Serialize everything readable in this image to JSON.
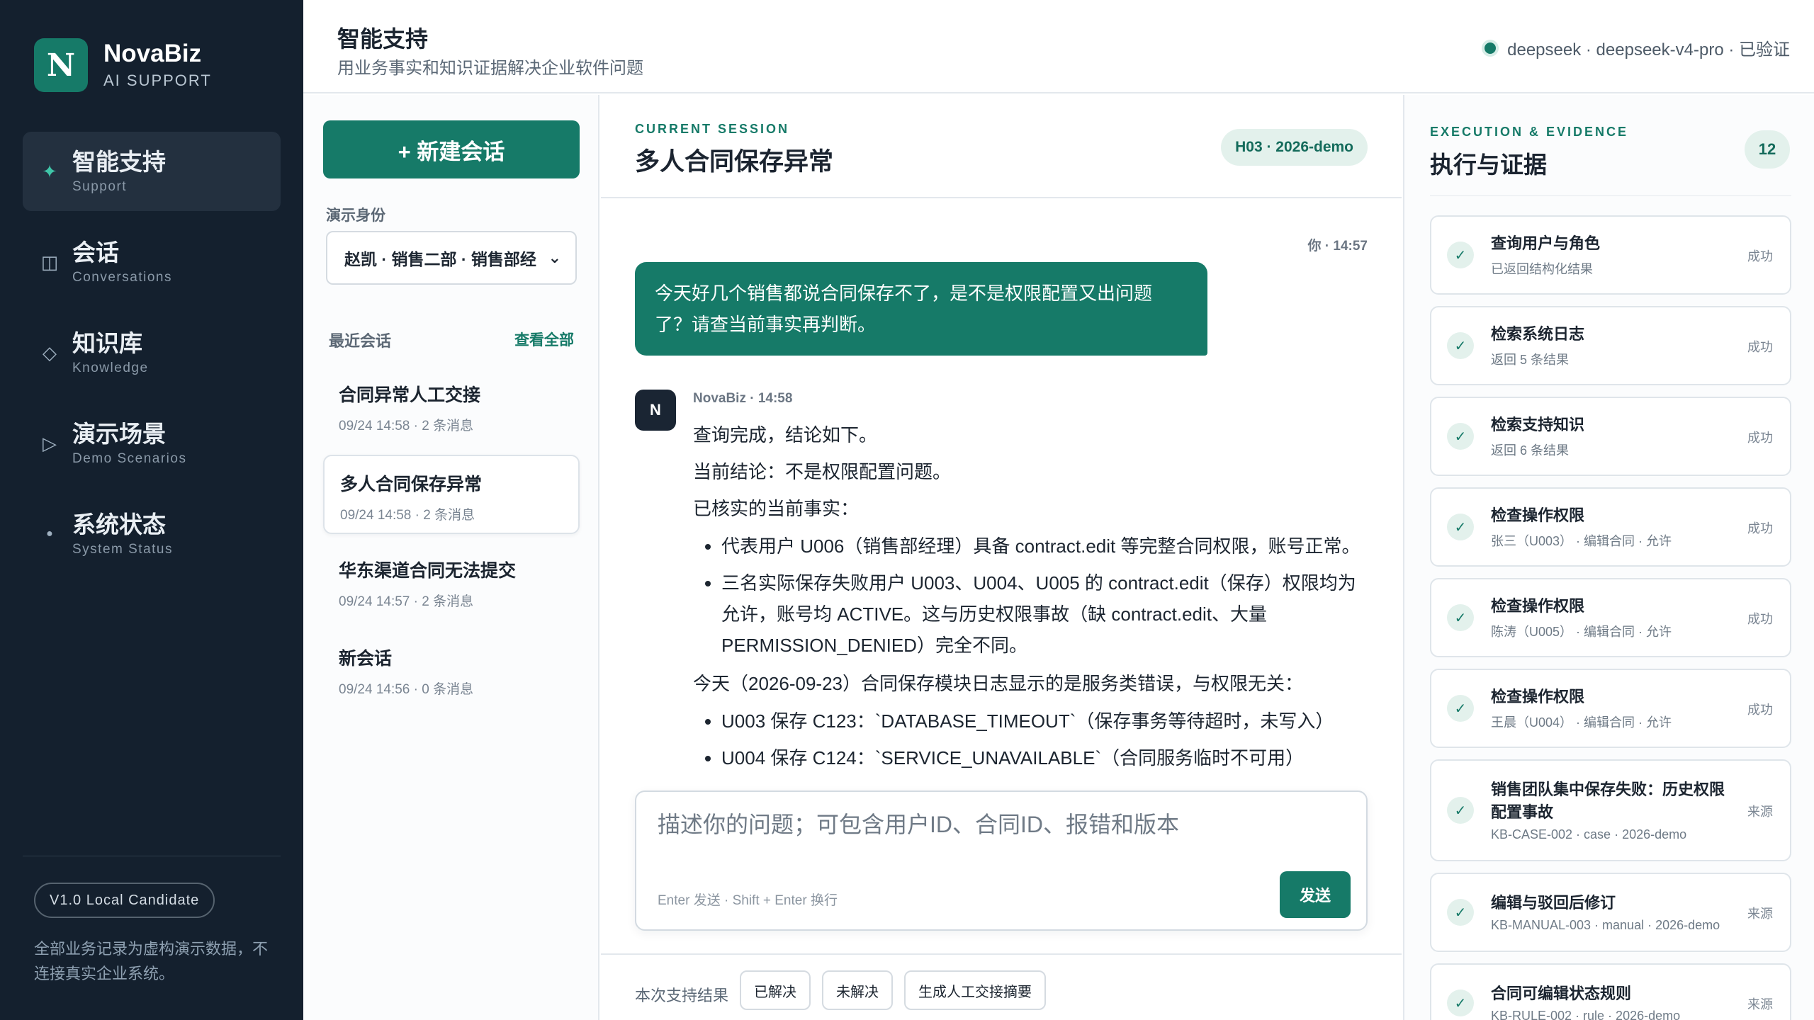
{
  "brand": {
    "logo": "N",
    "name": "NovaBiz",
    "subtitle": "AI SUPPORT"
  },
  "nav": [
    {
      "icon": "sparkle-icon",
      "glyph": "✦",
      "label": "智能支持",
      "sub": "Support",
      "active": true
    },
    {
      "icon": "columns-icon",
      "glyph": "◫",
      "label": "会话",
      "sub": "Conversations",
      "active": false
    },
    {
      "icon": "diamond-icon",
      "glyph": "◇",
      "label": "知识库",
      "sub": "Knowledge",
      "active": false
    },
    {
      "icon": "play-icon",
      "glyph": "▷",
      "label": "演示场景",
      "sub": "Demo Scenarios",
      "active": false
    },
    {
      "icon": "dot-icon",
      "glyph": "●",
      "label": "系统状态",
      "sub": "System Status",
      "active": false
    }
  ],
  "sidebar_footer": {
    "version": "V1.0 Local Candidate",
    "note": "全部业务记录为虚构演示数据，不连接真实企业系统。"
  },
  "header": {
    "title": "智能支持",
    "subtitle": "用业务事实和知识证据解决企业软件问题",
    "status": "deepseek · deepseek-v4-pro · 已验证"
  },
  "conversations": {
    "new_button": "+ 新建会话",
    "identity_label": "演示身份",
    "identity_value": "赵凯 · 销售二部 · 销售部经",
    "recent_label": "最近会话",
    "view_all": "查看全部",
    "items": [
      {
        "title": "合同异常人工交接",
        "meta": "09/24 14:58 · 2 条消息",
        "active": false
      },
      {
        "title": "多人合同保存异常",
        "meta": "09/24 14:58 · 2 条消息",
        "active": true
      },
      {
        "title": "华东渠道合同无法提交",
        "meta": "09/24 14:57 · 2 条消息",
        "active": false
      },
      {
        "title": "新会话",
        "meta": "09/24 14:56 · 0 条消息",
        "active": false
      }
    ]
  },
  "session": {
    "eyebrow": "CURRENT SESSION",
    "title": "多人合同保存异常",
    "tag": "H03 · 2026-demo"
  },
  "messages": {
    "user_meta": "你 · 14:57",
    "user_text": "今天好几个销售都说合同保存不了，是不是权限配置又出问题了？请查当前事实再判断。",
    "bot_avatar": "N",
    "bot_meta": "NovaBiz · 14:58",
    "bot_p1": "查询完成，结论如下。",
    "bot_p2": "当前结论：不是权限配置问题。",
    "bot_p3": "已核实的当前事实：",
    "bot_list1": [
      "代表用户 U006（销售部经理）具备 contract.edit 等完整合同权限，账号正常。",
      "三名实际保存失败用户 U003、U004、U005 的 contract.edit（保存）权限均为允许，账号均 ACTIVE。这与历史权限事故（缺 contract.edit、大量 PERMISSION_DENIED）完全不同。"
    ],
    "bot_p4": "今天（2026-09-23）合同保存模块日志显示的是服务类错误，与权限无关：",
    "bot_list2": [
      "U003 保存 C123：`DATABASE_TIMEOUT`（保存事务等待超时，未写入）",
      "U004 保存 C124：`SERVICE_UNAVAILABLE`（合同服务临时不可用）"
    ]
  },
  "composer": {
    "placeholder": "描述你的问题；可包含用户ID、合同ID、报错和版本",
    "hint": "Enter 发送 · Shift + Enter 换行",
    "send": "发送"
  },
  "result_bar": {
    "label": "本次支持结果",
    "resolved": "已解决",
    "unresolved": "未解决",
    "handoff": "生成人工交接摘要"
  },
  "evidence": {
    "eyebrow": "EXECUTION & EVIDENCE",
    "title": "执行与证据",
    "count": "12",
    "items": [
      {
        "name": "查询用户与角色",
        "desc": "已返回结构化结果",
        "status": "成功",
        "tall": false
      },
      {
        "name": "检索系统日志",
        "desc": "返回 5 条结果",
        "status": "成功",
        "tall": false
      },
      {
        "name": "检索支持知识",
        "desc": "返回 6 条结果",
        "status": "成功",
        "tall": false
      },
      {
        "name": "检查操作权限",
        "desc": "张三（U003） · 编辑合同 · 允许",
        "status": "成功",
        "tall": false
      },
      {
        "name": "检查操作权限",
        "desc": "陈涛（U005） · 编辑合同 · 允许",
        "status": "成功",
        "tall": false
      },
      {
        "name": "检查操作权限",
        "desc": "王晨（U004） · 编辑合同 · 允许",
        "status": "成功",
        "tall": false
      },
      {
        "name": "销售团队集中保存失败：历史权限配置事故",
        "desc": "KB-CASE-002 · case · 2026-demo",
        "status": "来源",
        "tall": true
      },
      {
        "name": "编辑与驳回后修订",
        "desc": "KB-MANUAL-003 · manual · 2026-demo",
        "status": "来源",
        "tall": false
      },
      {
        "name": "合同可编辑状态规则",
        "desc": "KB-RULE-002 · rule · 2026-demo",
        "status": "来源",
        "tall": false
      }
    ]
  }
}
